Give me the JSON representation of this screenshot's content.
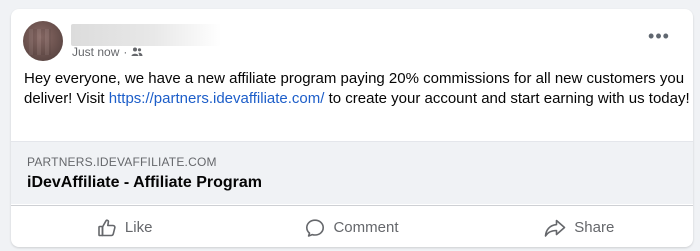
{
  "post": {
    "timestamp": "Just now",
    "separator": "·",
    "audience_icon": "friends-icon",
    "more_icon": "more-options-icon",
    "more_glyph": "•••",
    "text_before_link": "Hey everyone, we have a new affiliate program paying 20% commissions for all new customers you deliver! Visit ",
    "link_text": "https://partners.idevaffiliate.com/",
    "text_after_link": " to create your account and start earning with us today!"
  },
  "preview": {
    "domain": "PARTNERS.IDEVAFFILIATE.COM",
    "title": "iDevAffiliate - Affiliate Program"
  },
  "actions": {
    "like": {
      "label": "Like",
      "icon": "thumbs-up-icon"
    },
    "comment": {
      "label": "Comment",
      "icon": "comment-icon"
    },
    "share": {
      "label": "Share",
      "icon": "share-icon"
    }
  },
  "colors": {
    "link": "#1d5ec9",
    "secondary_text": "#65676b",
    "background": "#f0f2f5"
  }
}
